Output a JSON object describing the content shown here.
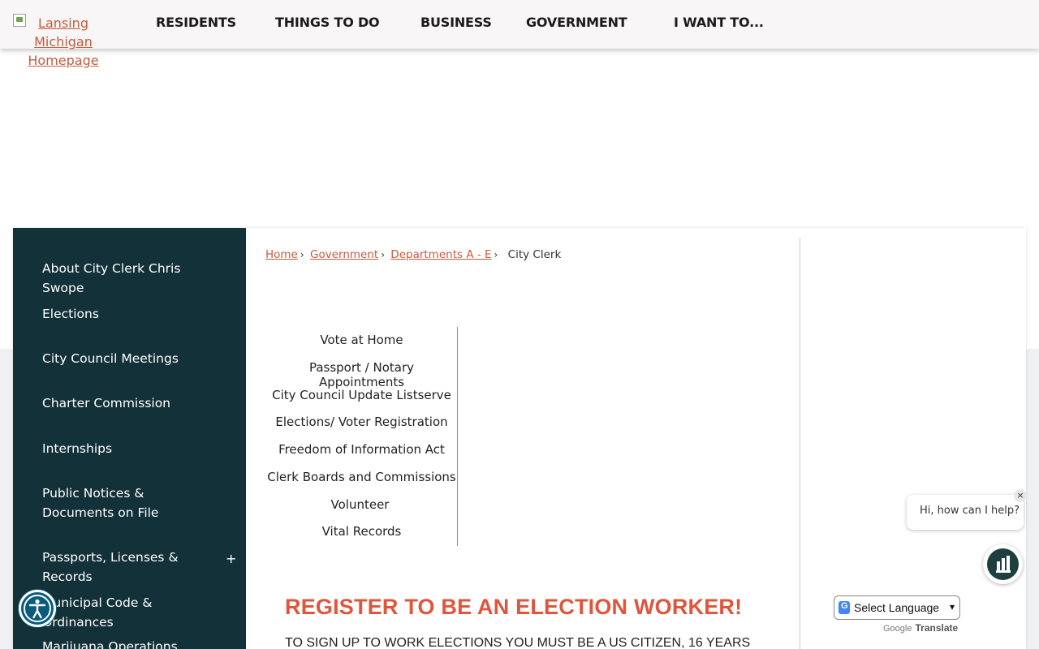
{
  "header": {
    "logo_alt": "Lansing Michigan Homepage",
    "logo_lines": [
      "Lansing",
      "Michigan",
      "Homepage"
    ],
    "nav": [
      "RESIDENTS",
      "THINGS TO DO",
      "BUSINESS",
      "GOVERNMENT",
      "I WANT TO..."
    ]
  },
  "sidebar": {
    "items": [
      "About City Clerk Chris Swope",
      "Elections",
      "City Council Meetings",
      "Charter Commission",
      "Internships",
      "Public Notices & Documents on File",
      "Passports, Licenses & Records",
      "Municipal Code & Ordinances",
      "Marijuana Operations"
    ],
    "expand_symbol": "+"
  },
  "breadcrumb": {
    "items": [
      "Home",
      " Government",
      " Departments A - E"
    ],
    "current": "City Clerk",
    "separator": "›"
  },
  "quick_links": [
    "Vote at Home",
    "Passport / Notary Appointments",
    "City Council Update Listserve",
    "Elections/ Voter Registration",
    "Freedom of Information Act",
    "Clerk Boards and Commissions",
    "Volunteer",
    "Vital Records"
  ],
  "content": {
    "headline": "REGISTER TO BE AN ELECTION WORKER!",
    "subtext": "TO SIGN UP TO WORK ELECTIONS YOU MUST BE A US CITIZEN, 16 YEARS"
  },
  "chat": {
    "greeting": "Hi, how can I help?",
    "close_symbol": "×"
  },
  "translate": {
    "select_label": "Select Language",
    "powered_by": "Google",
    "translate_label": "Translate"
  },
  "colors": {
    "sidebar_bg": "#133139",
    "accent_link": "#c65b3c",
    "headline": "#e0553b",
    "chat_icon": "#1e3f3f",
    "a11y": "#0b5b7a"
  }
}
